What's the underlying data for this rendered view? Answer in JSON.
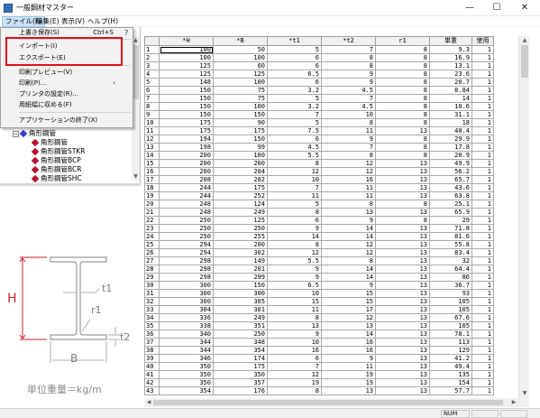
{
  "window": {
    "title": "一般鋼材マスター",
    "min_glyph": "—",
    "max_glyph": "☐",
    "close_glyph": "✕"
  },
  "menubar": {
    "items": [
      {
        "label": "ファイル(F)"
      },
      {
        "label": "編集(E)"
      },
      {
        "label": "表示(V)"
      },
      {
        "label": "ヘルプ(H)"
      }
    ]
  },
  "file_menu": {
    "items": [
      {
        "label": "上書き保存(S)",
        "accel": "Ctrl+S"
      },
      {
        "label": "インポート(I)"
      },
      {
        "label": "エクスポート(E)"
      },
      {
        "label": "印刷プレビュー(V)"
      },
      {
        "label": "印刷(P)...",
        "arrow": "›"
      },
      {
        "label": "プリンタの設定(R)..."
      },
      {
        "label": "用紙幅に収める(F)"
      },
      {
        "label": "アプリケーションの終了(X)"
      }
    ]
  },
  "tree": {
    "parent": {
      "expander": "−",
      "label": "角形鋼管"
    },
    "children": [
      {
        "label": "角形鋼管"
      },
      {
        "label": "角形鋼管STKR"
      },
      {
        "label": "角形鋼管BCP"
      },
      {
        "label": "角形鋼管BCR"
      },
      {
        "label": "角形鋼管SHC"
      }
    ]
  },
  "diagram": {
    "height_label": "H",
    "width_label": "B",
    "web_label": "t1",
    "flange_label": "t2",
    "radius_label": "r1",
    "unit_weight_label": "単位重量＝kg/m"
  },
  "table": {
    "columns": [
      "",
      "*H",
      "*B",
      "*t1",
      "*t2",
      "r1",
      "単重",
      "使用"
    ],
    "rows": [
      [
        "1",
        "100",
        "50",
        "5",
        "7",
        "8",
        "9.3",
        "1"
      ],
      [
        "2",
        "100",
        "100",
        "6",
        "8",
        "8",
        "16.9",
        "1"
      ],
      [
        "3",
        "125",
        "60",
        "6",
        "8",
        "8",
        "13.1",
        "1"
      ],
      [
        "4",
        "125",
        "125",
        "6.5",
        "9",
        "8",
        "23.6",
        "1"
      ],
      [
        "5",
        "148",
        "100",
        "6",
        "9",
        "8",
        "20.7",
        "1"
      ],
      [
        "6",
        "150",
        "75",
        "3.2",
        "4.5",
        "8",
        "8.84",
        "1"
      ],
      [
        "7",
        "150",
        "75",
        "5",
        "7",
        "8",
        "14",
        "1"
      ],
      [
        "8",
        "150",
        "100",
        "3.2",
        "4.5",
        "8",
        "10.6",
        "1"
      ],
      [
        "9",
        "150",
        "150",
        "7",
        "10",
        "8",
        "31.1",
        "1"
      ],
      [
        "10",
        "175",
        "90",
        "5",
        "8",
        "8",
        "18",
        "1"
      ],
      [
        "11",
        "175",
        "175",
        "7.5",
        "11",
        "13",
        "40.4",
        "1"
      ],
      [
        "12",
        "194",
        "150",
        "6",
        "9",
        "8",
        "29.9",
        "1"
      ],
      [
        "13",
        "198",
        "99",
        "4.5",
        "7",
        "8",
        "17.8",
        "1"
      ],
      [
        "14",
        "200",
        "100",
        "5.5",
        "8",
        "8",
        "20.9",
        "1"
      ],
      [
        "15",
        "200",
        "200",
        "8",
        "12",
        "13",
        "49.9",
        "1"
      ],
      [
        "16",
        "200",
        "204",
        "12",
        "12",
        "13",
        "56.2",
        "1"
      ],
      [
        "17",
        "208",
        "202",
        "10",
        "16",
        "13",
        "65.7",
        "1"
      ],
      [
        "18",
        "244",
        "175",
        "7",
        "11",
        "13",
        "43.6",
        "1"
      ],
      [
        "19",
        "244",
        "252",
        "11",
        "11",
        "13",
        "63.8",
        "1"
      ],
      [
        "20",
        "248",
        "124",
        "5",
        "8",
        "8",
        "25.1",
        "1"
      ],
      [
        "21",
        "248",
        "249",
        "8",
        "13",
        "13",
        "65.9",
        "1"
      ],
      [
        "22",
        "250",
        "125",
        "6",
        "9",
        "8",
        "29",
        "1"
      ],
      [
        "23",
        "250",
        "250",
        "9",
        "14",
        "13",
        "71.8",
        "1"
      ],
      [
        "24",
        "250",
        "255",
        "14",
        "14",
        "13",
        "81.6",
        "1"
      ],
      [
        "25",
        "294",
        "200",
        "8",
        "12",
        "13",
        "55.8",
        "1"
      ],
      [
        "26",
        "294",
        "302",
        "12",
        "12",
        "13",
        "83.4",
        "1"
      ],
      [
        "27",
        "298",
        "149",
        "5.5",
        "8",
        "13",
        "32",
        "1"
      ],
      [
        "28",
        "298",
        "201",
        "9",
        "14",
        "13",
        "64.4",
        "1"
      ],
      [
        "29",
        "298",
        "299",
        "9",
        "14",
        "13",
        "86",
        "1"
      ],
      [
        "30",
        "300",
        "150",
        "6.5",
        "9",
        "13",
        "36.7",
        "1"
      ],
      [
        "31",
        "300",
        "300",
        "10",
        "15",
        "13",
        "93",
        "1"
      ],
      [
        "32",
        "300",
        "305",
        "15",
        "15",
        "13",
        "105",
        "1"
      ],
      [
        "33",
        "304",
        "301",
        "11",
        "17",
        "13",
        "105",
        "1"
      ],
      [
        "34",
        "336",
        "249",
        "8",
        "12",
        "13",
        "67.6",
        "1"
      ],
      [
        "35",
        "338",
        "351",
        "13",
        "13",
        "13",
        "105",
        "1"
      ],
      [
        "36",
        "340",
        "250",
        "9",
        "14",
        "13",
        "78.1",
        "1"
      ],
      [
        "37",
        "344",
        "348",
        "10",
        "16",
        "13",
        "113",
        "1"
      ],
      [
        "38",
        "344",
        "354",
        "16",
        "16",
        "13",
        "129",
        "1"
      ],
      [
        "39",
        "346",
        "174",
        "6",
        "9",
        "13",
        "41.2",
        "1"
      ],
      [
        "40",
        "350",
        "175",
        "7",
        "11",
        "13",
        "49.4",
        "1"
      ],
      [
        "41",
        "350",
        "350",
        "12",
        "19",
        "13",
        "135",
        "1"
      ],
      [
        "42",
        "350",
        "357",
        "19",
        "19",
        "13",
        "154",
        "1"
      ],
      [
        "43",
        "354",
        "176",
        "8",
        "13",
        "13",
        "57.7",
        "1"
      ]
    ]
  },
  "status": {
    "num_label": "NUM"
  }
}
